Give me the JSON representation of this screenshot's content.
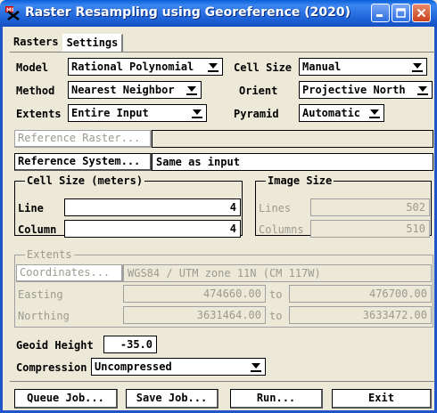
{
  "window": {
    "title": "Raster Resampling using Georeference (2020)",
    "icon": "mi-app-icon",
    "controls": [
      "minimize-icon",
      "maximize-icon",
      "close-icon"
    ]
  },
  "tabs": [
    {
      "label": "Rasters",
      "active": false
    },
    {
      "label": "Settings",
      "active": true
    }
  ],
  "settings": {
    "model_label": "Model",
    "model_value": "Rational Polynomial",
    "cellsize_label": "Cell Size",
    "cellsize_value": "Manual",
    "method_label": "Method",
    "method_value": "Nearest Neighbor",
    "orient_label": "Orient",
    "orient_value": "Projective North",
    "extents_label": "Extents",
    "extents_value": "Entire Input",
    "pyramid_label": "Pyramid",
    "pyramid_value": "Automatic",
    "reference_raster_button": "Reference Raster...",
    "reference_raster_value": "",
    "reference_system_button": "Reference System...",
    "reference_system_value": "Same as input"
  },
  "cell_size": {
    "title": "Cell Size (meters)",
    "line_label": "Line",
    "line_value": "4",
    "column_label": "Column",
    "column_value": "4"
  },
  "image_size": {
    "title": "Image Size",
    "lines_label": "Lines",
    "lines_value": "502",
    "columns_label": "Columns",
    "columns_value": "510"
  },
  "extents_group": {
    "title": "Extents",
    "coordinates_button": "Coordinates...",
    "coordinates_value": "WGS84 / UTM zone 11N (CM 117W)",
    "easting_label": "Easting",
    "easting_from": "474660.00",
    "easting_to": "476700.00",
    "northing_label": "Northing",
    "northing_from": "3631464.00",
    "northing_to": "3633472.00",
    "to_label": "to"
  },
  "geoid": {
    "label": "Geoid Height",
    "value": "-35.0"
  },
  "compression": {
    "label": "Compression",
    "value": "Uncompressed"
  },
  "buttons": {
    "queue_job": "Queue Job...",
    "save_job": "Save Job...",
    "run": "Run...",
    "exit": "Exit"
  },
  "colors": {
    "titlebar": "#1f63d8",
    "background": "#ece9d8",
    "disabled_text": "#9c9a90",
    "close_button": "#c9411d"
  }
}
